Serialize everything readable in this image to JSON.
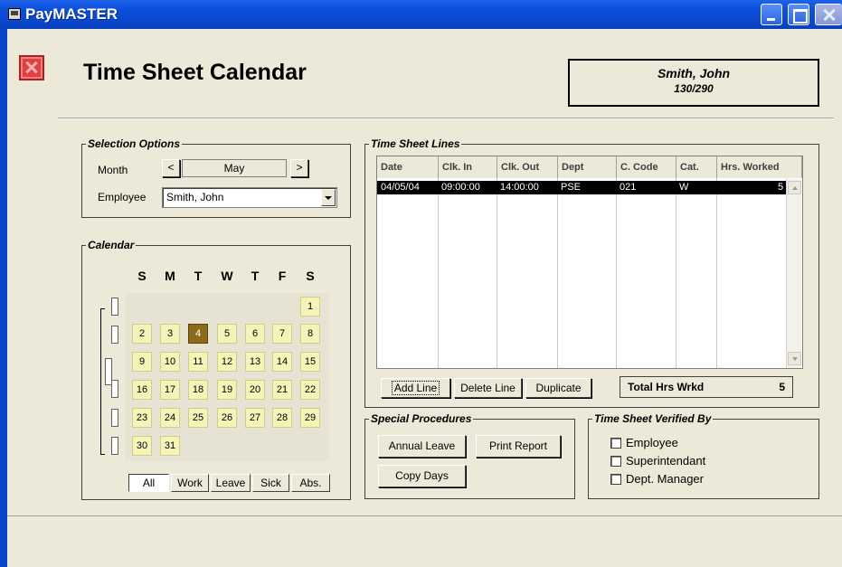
{
  "window": {
    "title": "PayMASTER"
  },
  "header": {
    "title": "Time Sheet Calendar",
    "employee_name": "Smith, John",
    "employee_code": "130/290"
  },
  "selection": {
    "group_title": "Selection Options",
    "month_label": "Month",
    "month_value": "May",
    "prev_glyph": "<",
    "next_glyph": ">",
    "employee_label": "Employee",
    "employee_value": "Smith, John"
  },
  "calendar": {
    "group_title": "Calendar",
    "weekdays": [
      "S",
      "M",
      "T",
      "W",
      "T",
      "F",
      "S"
    ],
    "selected_day": "4",
    "filters": [
      "All",
      "Work",
      "Leave",
      "Sick",
      "Abs."
    ],
    "active_filter": "All"
  },
  "timesheet": {
    "group_title": "Time Sheet Lines",
    "columns": [
      "Date",
      "Clk. In",
      "Clk. Out",
      "Dept",
      "C. Code",
      "Cat.",
      "Hrs. Worked"
    ],
    "rows": [
      {
        "date": "04/05/04",
        "clk_in": "09:00:00",
        "clk_out": "14:00:00",
        "dept": "PSE",
        "code": "021",
        "cat": "W",
        "hours": "5"
      }
    ],
    "add_line": "Add Line",
    "delete_line": "Delete Line",
    "duplicate": "Duplicate",
    "total_label": "Total Hrs Wrkd",
    "total_value": "5"
  },
  "special": {
    "group_title": "Special Procedures",
    "annual_leave": "Annual Leave",
    "print_report": "Print Report",
    "copy_days": "Copy Days"
  },
  "verified": {
    "group_title": "Time Sheet Verified By",
    "employee": "Employee",
    "superintendant": "Superintendant",
    "dept_manager": "Dept. Manager"
  },
  "colors": {
    "titlebar": "#0a46cc",
    "calendar_day": "#f6f3b8",
    "calendar_selected": "#8b6a1a",
    "close_button": "#e04040"
  }
}
